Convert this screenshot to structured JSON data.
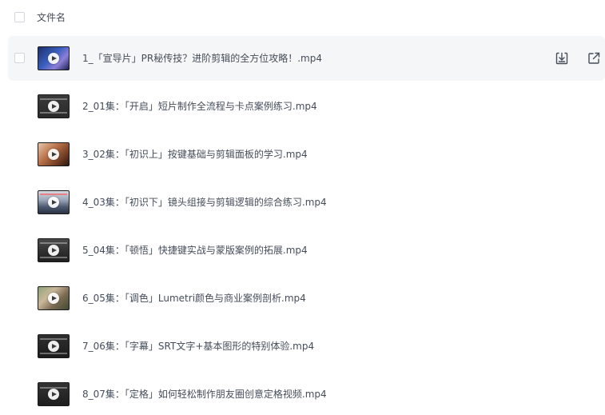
{
  "header": {
    "column_label": "文件名"
  },
  "files": [
    {
      "name": "1_「宣导片」PR秘传技？进阶剪辑的全方位攻略！.mp4",
      "thumb_icon": "video-thumbnail"
    },
    {
      "name": "2_01集：「开启」短片制作全流程与卡点案例练习.mp4",
      "thumb_icon": "video-thumbnail"
    },
    {
      "name": "3_02集：「初识上」按键基础与剪辑面板的学习.mp4",
      "thumb_icon": "video-thumbnail"
    },
    {
      "name": "4_03集：「初识下」镜头组接与剪辑逻辑的综合练习.mp4",
      "thumb_icon": "video-thumbnail"
    },
    {
      "name": "5_04集：「顿悟」快捷键实战与蒙版案例的拓展.mp4",
      "thumb_icon": "video-thumbnail"
    },
    {
      "name": "6_05集：「调色」Lumetri颜色与商业案例剖析.mp4",
      "thumb_icon": "video-thumbnail"
    },
    {
      "name": "7_06集：「字幕」SRT文字+基本图形的特别体验.mp4",
      "thumb_icon": "video-thumbnail"
    },
    {
      "name": "8_07集：「定格」如何轻松制作朋友圈创意定格视频.mp4",
      "thumb_icon": "video-thumbnail"
    }
  ],
  "row_actions": {
    "download_icon": "download-icon",
    "share_icon": "share-icon"
  },
  "colors": {
    "text": "#454d5a",
    "hover_row_bg": "#f5f6f7",
    "checkbox_border": "#d3d6dc"
  }
}
